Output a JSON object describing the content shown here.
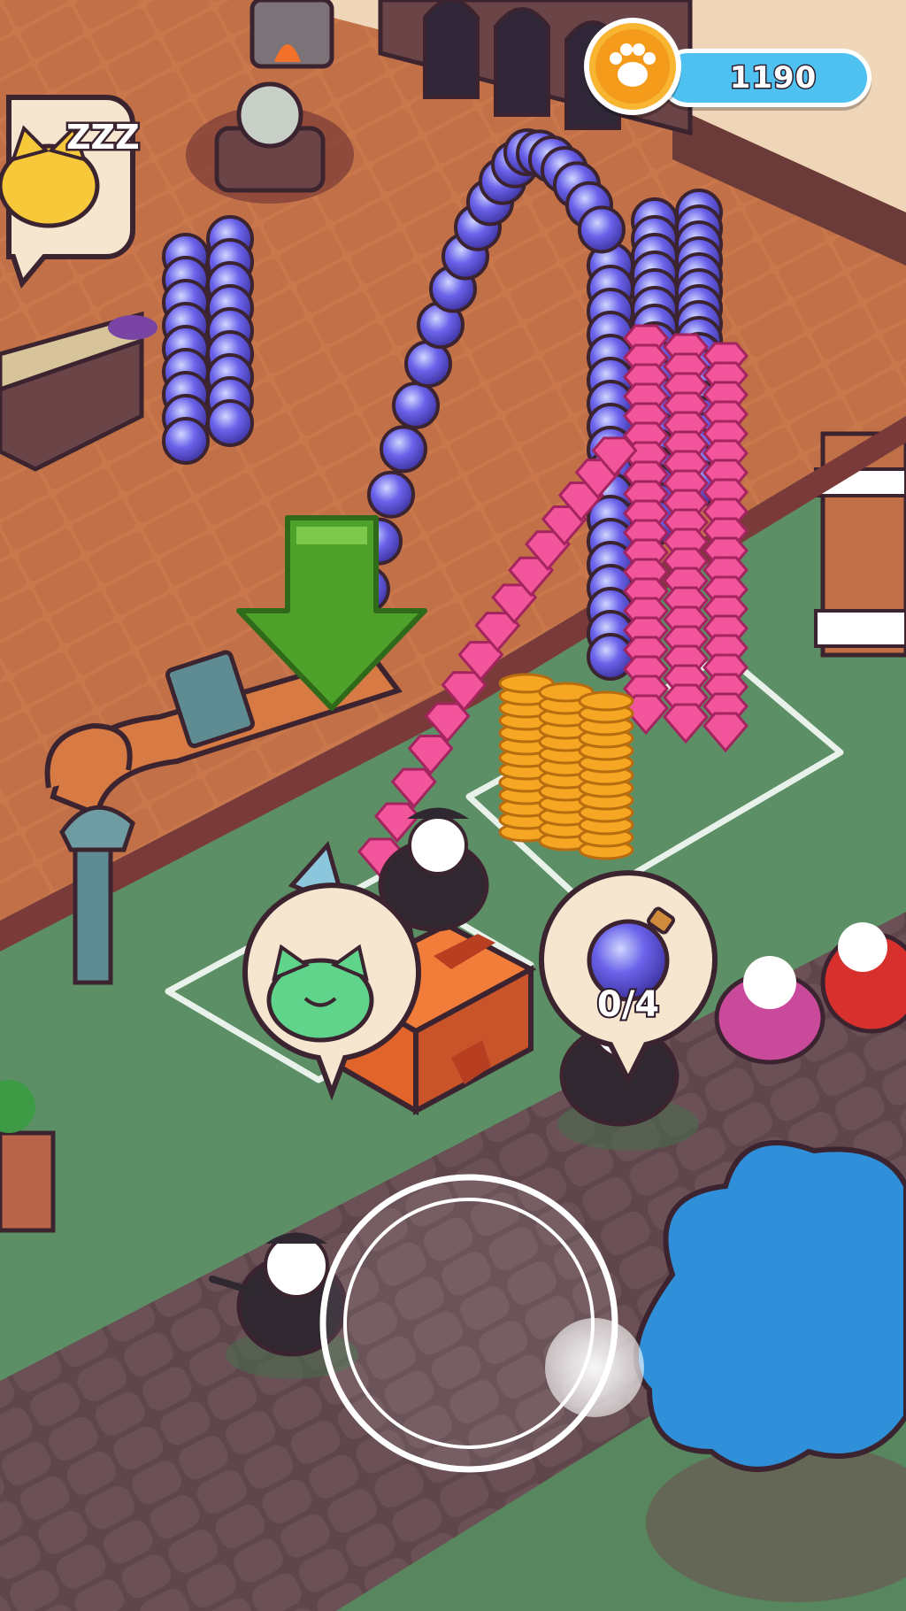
{
  "hud": {
    "coin_count": "1190",
    "coin_icon": "paw-coin-icon"
  },
  "order_bubble": {
    "icon": "potion-icon",
    "progress_text": "0/4",
    "progress_fraction": 0
  },
  "status_bubbles": [
    {
      "icon": "sleeping-cat-icon",
      "text": "ZZZ"
    },
    {
      "icon": "happy-green-cat-icon"
    }
  ],
  "guide_arrow": {
    "icon": "down-arrow-icon"
  },
  "joystick": {
    "icon": "virtual-joystick"
  },
  "colors": {
    "coin_bar": "#4fc1f0",
    "coin": "#f59b1c",
    "floor": "#c9774b",
    "grass": "#5d8f66",
    "path": "#6b5156",
    "potion": "#5a52d8",
    "gem": "#f2559b",
    "arrow": "#4ea12a"
  }
}
